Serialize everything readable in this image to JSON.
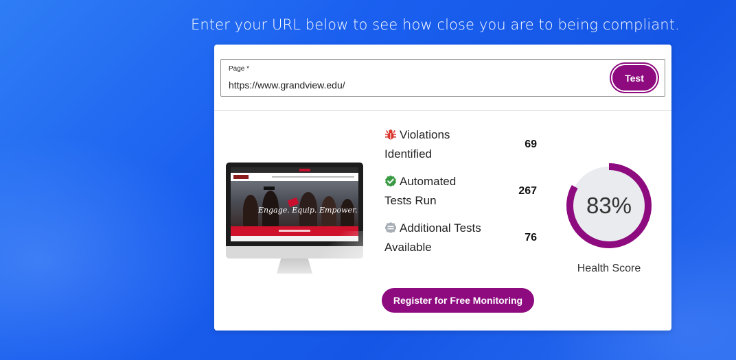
{
  "headline": "Enter your URL below to see how close you are to being compliant.",
  "form": {
    "page_label": "Page *",
    "url_value": "https://www.grandview.edu/",
    "test_button": "Test"
  },
  "preview": {
    "hero_text": "Engage. Equip. Empower."
  },
  "stats": [
    {
      "icon": "bug-icon",
      "color": "#d9342b",
      "line1": "Violations",
      "line2": "Identified",
      "value": "69"
    },
    {
      "icon": "check-circle-icon",
      "color": "#3a9a44",
      "line1": "Automated",
      "line2": "Tests Run",
      "value": "267"
    },
    {
      "icon": "clipboard-icon",
      "color": "#a6adb5",
      "line1": "Additional Tests",
      "line2": "Available",
      "value": "76"
    }
  ],
  "health": {
    "score_text": "83%",
    "score_fraction": 0.83,
    "caption": "Health Score",
    "track_color": "#e6e8ec",
    "fill_color": "#8e0a7f"
  },
  "register_button": "Register for Free Monitoring",
  "colors": {
    "accent": "#8e0a7f",
    "background": "#1a5fef"
  }
}
